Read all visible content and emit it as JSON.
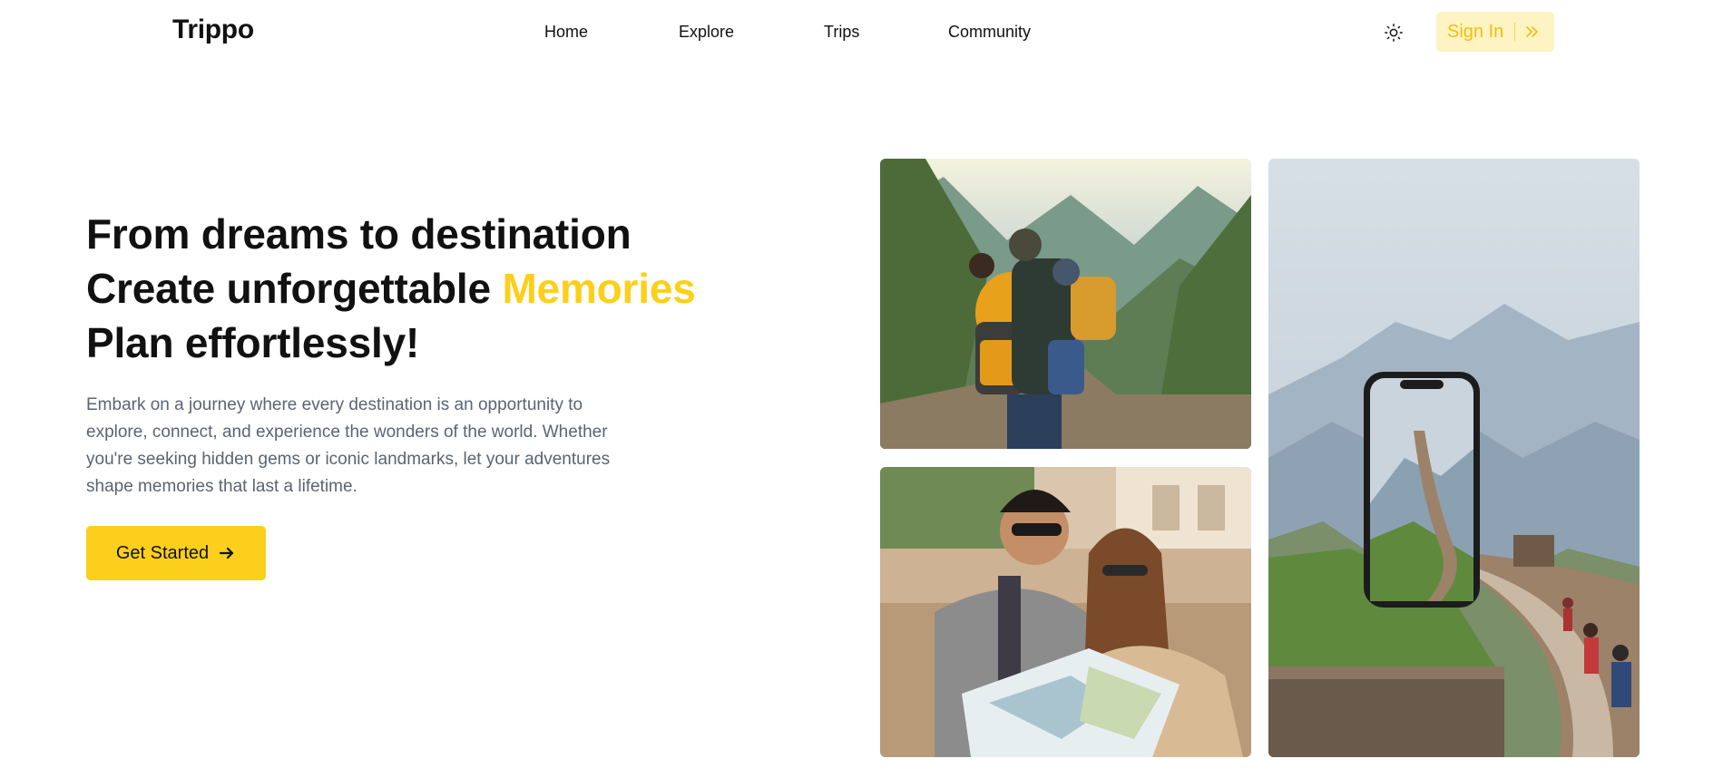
{
  "navbar": {
    "brand": "Trippo",
    "links": [
      "Home",
      "Explore",
      "Trips",
      "Community"
    ],
    "theme_toggle_icon": "sun-icon",
    "signin_label": "Sign In",
    "signin_icon": "double-chevron-right-icon"
  },
  "hero": {
    "heading_line1": "From dreams to destination",
    "heading_line2_prefix": "Create unforgettable ",
    "heading_line2_accent": "Memories",
    "heading_line3": "Plan effortlessly!",
    "description": "Embark on a journey where every destination is an opportunity to explore, connect, and experience the wonders of the world. Whether you're seeking hidden gems or iconic landmarks, let your adventures shape memories that last a lifetime.",
    "cta_label": "Get Started",
    "cta_icon": "arrow-right-icon"
  },
  "gallery": {
    "images": [
      {
        "subject": "family-hiking-mountains"
      },
      {
        "subject": "couple-reading-map"
      },
      {
        "subject": "great-wall-phone"
      }
    ]
  },
  "colors": {
    "accent": "#fcd01a",
    "signin_bg": "#fef3c2",
    "signin_text": "#f2be0d",
    "body_text": "#5b6472"
  }
}
